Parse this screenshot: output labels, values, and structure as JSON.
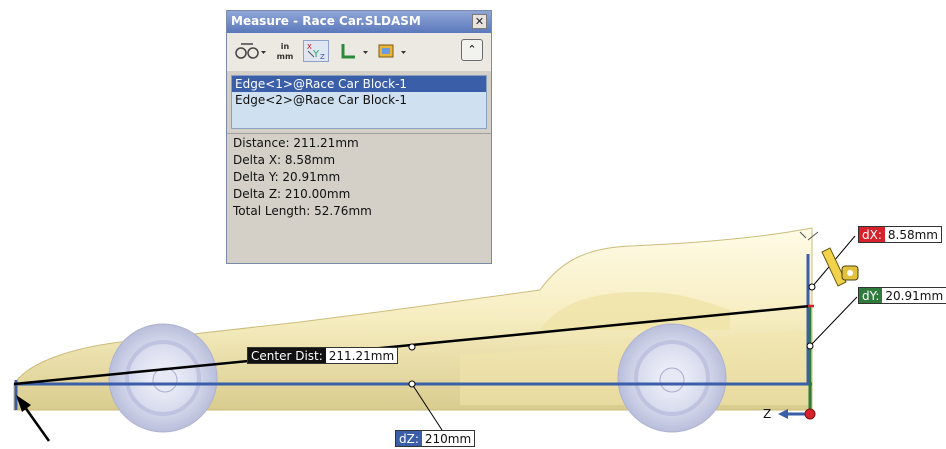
{
  "dialog": {
    "title": "Measure - Race Car.SLDASM",
    "close_glyph": "✕",
    "toolbar": {
      "arc_circle_icon": "arc-circle-measure-icon",
      "units_top": "in",
      "units_bottom": "mm",
      "xyz_label": "XYZ",
      "collapse_glyph": "⌃"
    },
    "selections": [
      "Edge<1>@Race Car Block-1",
      "Edge<2>@Race Car Block-1"
    ],
    "results": [
      "Distance: 211.21mm",
      "Delta X: 8.58mm",
      "Delta Y: 20.91mm",
      "Delta Z: 210.00mm",
      "Total Length: 52.76mm"
    ]
  },
  "callouts": {
    "dx": {
      "label": "dX:",
      "value": "8.58mm"
    },
    "dy": {
      "label": "dY:",
      "value": "20.91mm"
    },
    "dz": {
      "label": "dZ:",
      "value": "210mm"
    },
    "center": {
      "label": "Center Dist:",
      "value": "211.21mm"
    }
  },
  "triad": {
    "z_label": "Z"
  },
  "colors": {
    "body": "#f7efc2",
    "wheel": "#cfd2e8",
    "edge_blue": "#3b5ea8",
    "measure_line": "#000000",
    "dx_red": "#d8222b",
    "dy_green": "#2e7b3c"
  }
}
